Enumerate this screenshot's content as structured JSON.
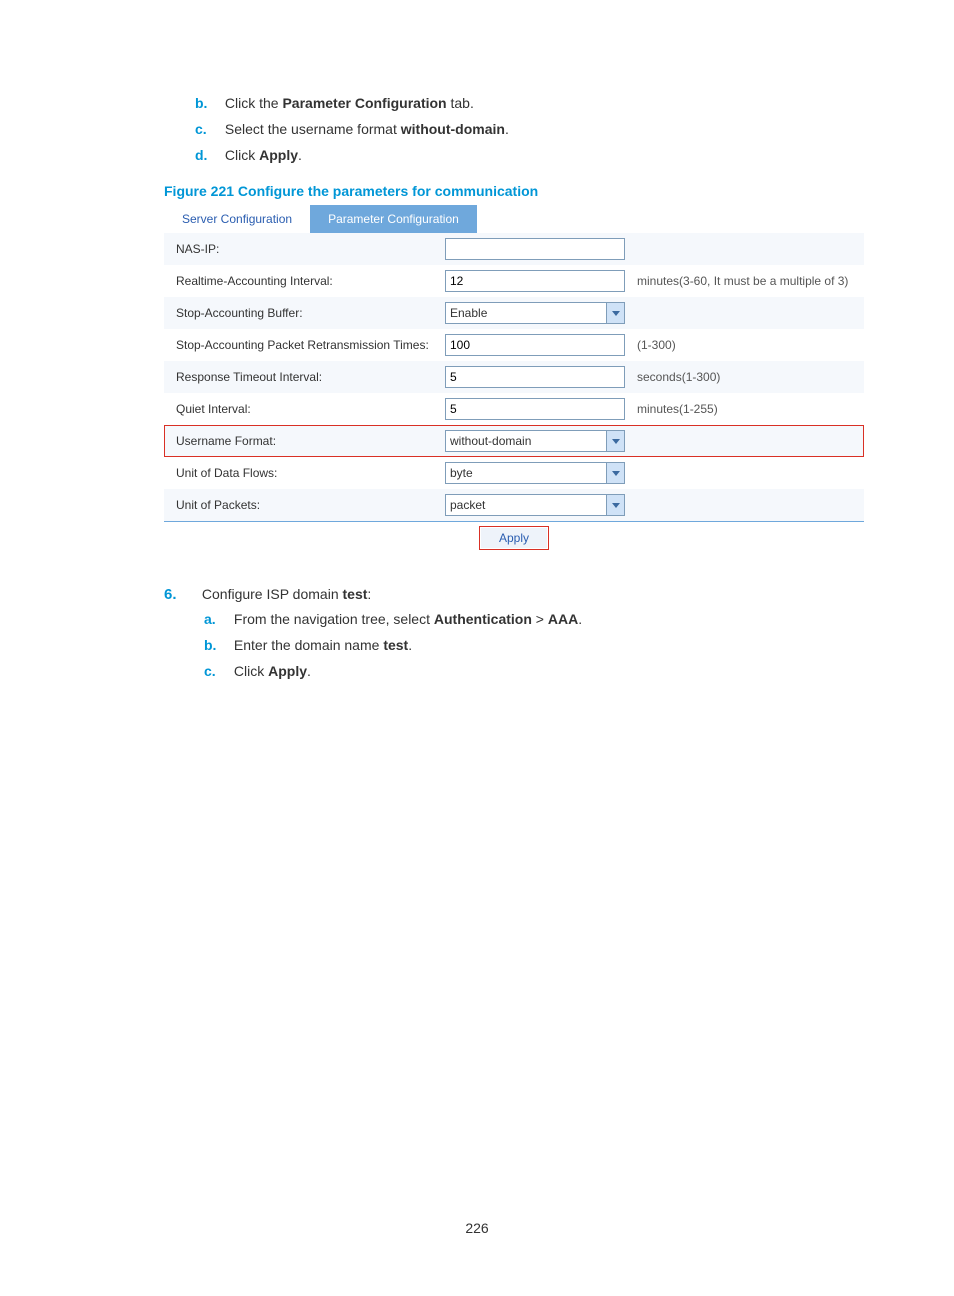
{
  "topSteps": [
    {
      "letter": "b.",
      "prefix": "Click the ",
      "bold": "Parameter Configuration",
      "suffix": " tab."
    },
    {
      "letter": "c.",
      "prefix": "Select the username format ",
      "bold": "without-domain",
      "suffix": "."
    },
    {
      "letter": "d.",
      "prefix": "Click ",
      "bold": "Apply",
      "suffix": "."
    }
  ],
  "figureCaption": "Figure 221 Configure the parameters for communication",
  "tabs": {
    "inactive": "Server Configuration",
    "active": "Parameter Configuration"
  },
  "rows": {
    "nasip": {
      "label": "NAS-IP:",
      "value": "",
      "hint": ""
    },
    "rtacct": {
      "label": "Realtime-Accounting Interval:",
      "value": "12",
      "hint": "minutes(3-60, It must be a multiple of 3)"
    },
    "stopbuf": {
      "label": "Stop-Accounting Buffer:",
      "value": "Enable",
      "hint": ""
    },
    "retrans": {
      "label": "Stop-Accounting Packet Retransmission Times:",
      "value": "100",
      "hint": "(1-300)"
    },
    "resp": {
      "label": "Response Timeout Interval:",
      "value": "5",
      "hint": "seconds(1-300)"
    },
    "quiet": {
      "label": "Quiet Interval:",
      "value": "5",
      "hint": "minutes(1-255)"
    },
    "uname": {
      "label": "Username Format:",
      "value": "without-domain",
      "hint": ""
    },
    "data": {
      "label": "Unit of Data Flows:",
      "value": "byte",
      "hint": ""
    },
    "pkt": {
      "label": "Unit of Packets:",
      "value": "packet",
      "hint": ""
    }
  },
  "apply": "Apply",
  "step6": {
    "number": "6.",
    "text_pre": "Configure ISP domain ",
    "text_bold": "test",
    "text_suf": ":",
    "subs": [
      {
        "letter": "a.",
        "pre": "From the navigation tree, select ",
        "b1": "Authentication",
        "mid": " > ",
        "b2": "AAA",
        "suf": "."
      },
      {
        "letter": "b.",
        "pre": "Enter the domain name ",
        "b1": "test",
        "mid": "",
        "b2": "",
        "suf": "."
      },
      {
        "letter": "c.",
        "pre": "Click ",
        "b1": "Apply",
        "mid": "",
        "b2": "",
        "suf": "."
      }
    ]
  },
  "pageNumber": "226"
}
